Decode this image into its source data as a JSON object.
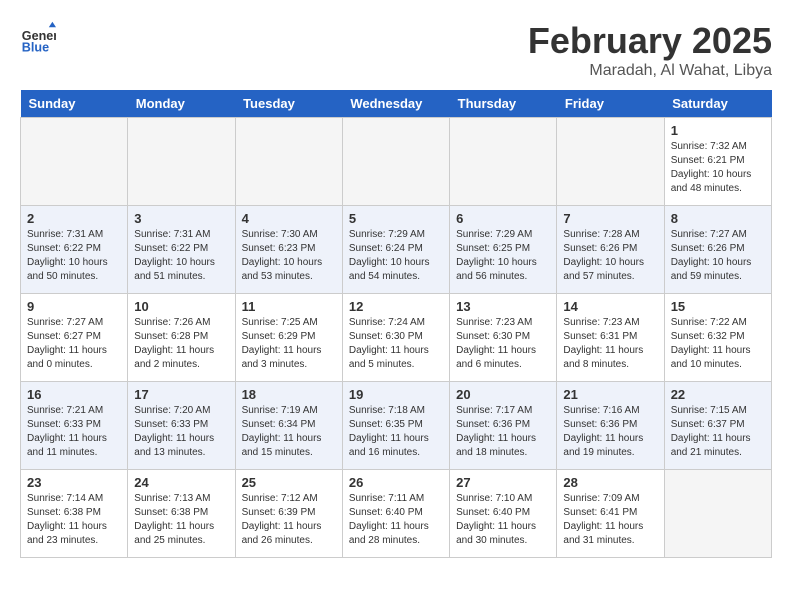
{
  "logo": {
    "line1": "General",
    "line2": "Blue"
  },
  "title": "February 2025",
  "location": "Maradah, Al Wahat, Libya",
  "days_of_week": [
    "Sunday",
    "Monday",
    "Tuesday",
    "Wednesday",
    "Thursday",
    "Friday",
    "Saturday"
  ],
  "weeks": [
    [
      {
        "day": "",
        "info": ""
      },
      {
        "day": "",
        "info": ""
      },
      {
        "day": "",
        "info": ""
      },
      {
        "day": "",
        "info": ""
      },
      {
        "day": "",
        "info": ""
      },
      {
        "day": "",
        "info": ""
      },
      {
        "day": "1",
        "info": "Sunrise: 7:32 AM\nSunset: 6:21 PM\nDaylight: 10 hours and 48 minutes."
      }
    ],
    [
      {
        "day": "2",
        "info": "Sunrise: 7:31 AM\nSunset: 6:22 PM\nDaylight: 10 hours and 50 minutes."
      },
      {
        "day": "3",
        "info": "Sunrise: 7:31 AM\nSunset: 6:22 PM\nDaylight: 10 hours and 51 minutes."
      },
      {
        "day": "4",
        "info": "Sunrise: 7:30 AM\nSunset: 6:23 PM\nDaylight: 10 hours and 53 minutes."
      },
      {
        "day": "5",
        "info": "Sunrise: 7:29 AM\nSunset: 6:24 PM\nDaylight: 10 hours and 54 minutes."
      },
      {
        "day": "6",
        "info": "Sunrise: 7:29 AM\nSunset: 6:25 PM\nDaylight: 10 hours and 56 minutes."
      },
      {
        "day": "7",
        "info": "Sunrise: 7:28 AM\nSunset: 6:26 PM\nDaylight: 10 hours and 57 minutes."
      },
      {
        "day": "8",
        "info": "Sunrise: 7:27 AM\nSunset: 6:26 PM\nDaylight: 10 hours and 59 minutes."
      }
    ],
    [
      {
        "day": "9",
        "info": "Sunrise: 7:27 AM\nSunset: 6:27 PM\nDaylight: 11 hours and 0 minutes."
      },
      {
        "day": "10",
        "info": "Sunrise: 7:26 AM\nSunset: 6:28 PM\nDaylight: 11 hours and 2 minutes."
      },
      {
        "day": "11",
        "info": "Sunrise: 7:25 AM\nSunset: 6:29 PM\nDaylight: 11 hours and 3 minutes."
      },
      {
        "day": "12",
        "info": "Sunrise: 7:24 AM\nSunset: 6:30 PM\nDaylight: 11 hours and 5 minutes."
      },
      {
        "day": "13",
        "info": "Sunrise: 7:23 AM\nSunset: 6:30 PM\nDaylight: 11 hours and 6 minutes."
      },
      {
        "day": "14",
        "info": "Sunrise: 7:23 AM\nSunset: 6:31 PM\nDaylight: 11 hours and 8 minutes."
      },
      {
        "day": "15",
        "info": "Sunrise: 7:22 AM\nSunset: 6:32 PM\nDaylight: 11 hours and 10 minutes."
      }
    ],
    [
      {
        "day": "16",
        "info": "Sunrise: 7:21 AM\nSunset: 6:33 PM\nDaylight: 11 hours and 11 minutes."
      },
      {
        "day": "17",
        "info": "Sunrise: 7:20 AM\nSunset: 6:33 PM\nDaylight: 11 hours and 13 minutes."
      },
      {
        "day": "18",
        "info": "Sunrise: 7:19 AM\nSunset: 6:34 PM\nDaylight: 11 hours and 15 minutes."
      },
      {
        "day": "19",
        "info": "Sunrise: 7:18 AM\nSunset: 6:35 PM\nDaylight: 11 hours and 16 minutes."
      },
      {
        "day": "20",
        "info": "Sunrise: 7:17 AM\nSunset: 6:36 PM\nDaylight: 11 hours and 18 minutes."
      },
      {
        "day": "21",
        "info": "Sunrise: 7:16 AM\nSunset: 6:36 PM\nDaylight: 11 hours and 19 minutes."
      },
      {
        "day": "22",
        "info": "Sunrise: 7:15 AM\nSunset: 6:37 PM\nDaylight: 11 hours and 21 minutes."
      }
    ],
    [
      {
        "day": "23",
        "info": "Sunrise: 7:14 AM\nSunset: 6:38 PM\nDaylight: 11 hours and 23 minutes."
      },
      {
        "day": "24",
        "info": "Sunrise: 7:13 AM\nSunset: 6:38 PM\nDaylight: 11 hours and 25 minutes."
      },
      {
        "day": "25",
        "info": "Sunrise: 7:12 AM\nSunset: 6:39 PM\nDaylight: 11 hours and 26 minutes."
      },
      {
        "day": "26",
        "info": "Sunrise: 7:11 AM\nSunset: 6:40 PM\nDaylight: 11 hours and 28 minutes."
      },
      {
        "day": "27",
        "info": "Sunrise: 7:10 AM\nSunset: 6:40 PM\nDaylight: 11 hours and 30 minutes."
      },
      {
        "day": "28",
        "info": "Sunrise: 7:09 AM\nSunset: 6:41 PM\nDaylight: 11 hours and 31 minutes."
      },
      {
        "day": "",
        "info": ""
      }
    ]
  ]
}
